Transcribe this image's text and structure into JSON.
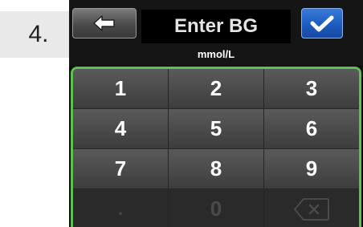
{
  "step": {
    "label": "4."
  },
  "header": {
    "title": "Enter BG",
    "unit": "mmol/L",
    "back_icon": "arrow-left-icon",
    "confirm_icon": "checkmark-icon"
  },
  "keypad": {
    "rows": [
      [
        "1",
        "2",
        "3"
      ],
      [
        "4",
        "5",
        "6"
      ],
      [
        "7",
        "8",
        "9"
      ]
    ],
    "decimal_label": ".",
    "zero_label": "0",
    "backspace_icon": "backspace-icon"
  },
  "colors": {
    "accent_border": "#5fbf52",
    "confirm_button": "#1d5bc0"
  }
}
